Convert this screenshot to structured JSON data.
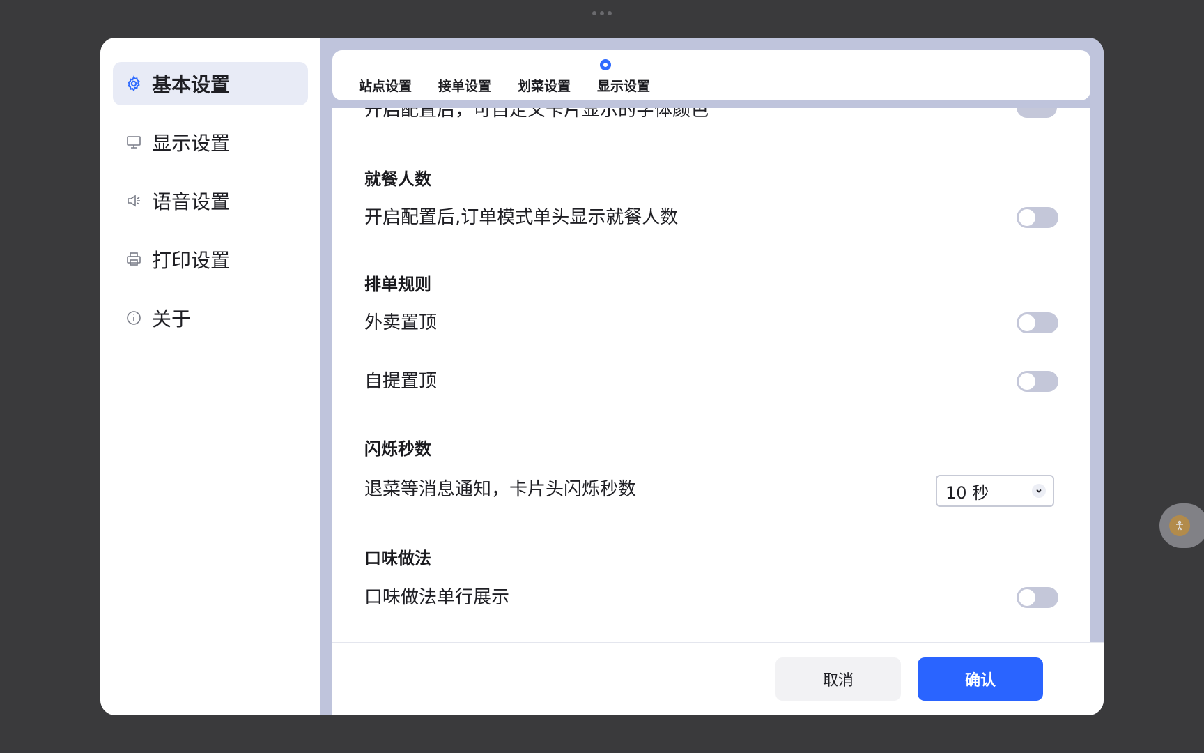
{
  "sidebar": {
    "items": [
      {
        "label": "基本设置",
        "icon": "gear-icon",
        "active": true
      },
      {
        "label": "显示设置",
        "icon": "monitor-icon",
        "active": false
      },
      {
        "label": "语音设置",
        "icon": "speaker-icon",
        "active": false
      },
      {
        "label": "打印设置",
        "icon": "printer-icon",
        "active": false
      },
      {
        "label": "关于",
        "icon": "info-icon",
        "active": false
      }
    ]
  },
  "tabs": [
    {
      "label": "站点设置"
    },
    {
      "label": "接单设置"
    },
    {
      "label": "划菜设置"
    },
    {
      "label": "显示设置",
      "active": true
    }
  ],
  "content": {
    "cut_off_text": "开启配置后，可自定义卡片显示的字体颜色",
    "sections": [
      {
        "title": "就餐人数",
        "rows": [
          {
            "label": "开启配置后,订单模式单头显示就餐人数",
            "enabled": false
          }
        ]
      },
      {
        "title": "排单规则",
        "rows": [
          {
            "label": "外卖置顶",
            "enabled": false
          },
          {
            "label": "自提置顶",
            "enabled": false
          }
        ]
      },
      {
        "title": "闪烁秒数",
        "rows": [
          {
            "label": "退菜等消息通知，卡片头闪烁秒数",
            "select_value": "10 秒"
          }
        ]
      },
      {
        "title": "口味做法",
        "rows": [
          {
            "label": "口味做法单行展示",
            "enabled": false
          }
        ]
      }
    ]
  },
  "footer": {
    "cancel_label": "取消",
    "confirm_label": "确认"
  },
  "colors": {
    "accent": "#2a64ff",
    "toggle_off": "#c4c7d9",
    "active_nav_bg": "#e8ebf6"
  }
}
